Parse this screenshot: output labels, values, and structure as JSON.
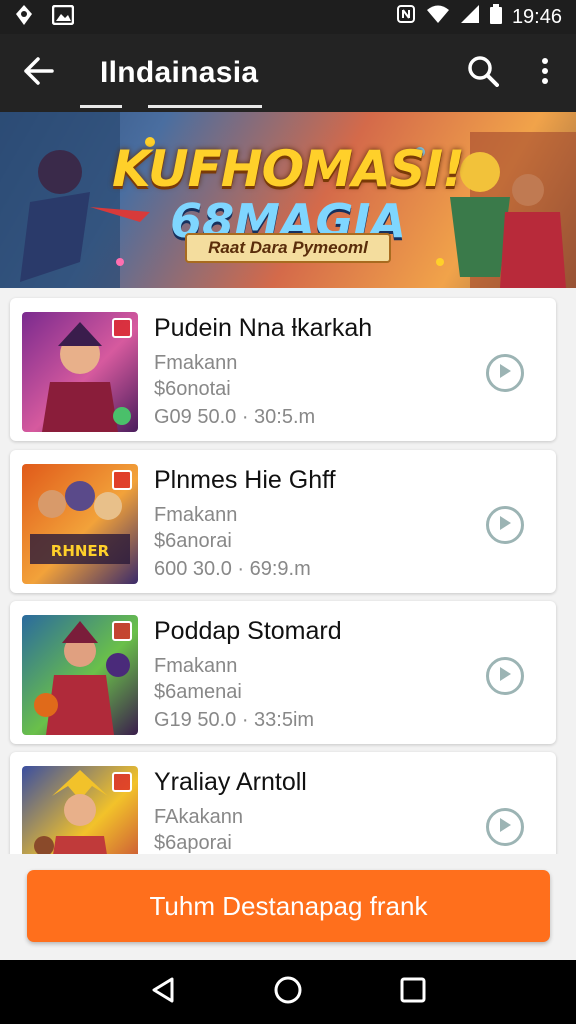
{
  "status_bar": {
    "time": "19:46",
    "icons": [
      "location-icon",
      "image-icon",
      "nfc-icon",
      "wifi-icon",
      "signal-icon",
      "battery-icon"
    ]
  },
  "app_bar": {
    "title": "Ilndainasia",
    "icons": [
      "back-arrow-icon",
      "search-icon",
      "more-vert-icon"
    ]
  },
  "banner": {
    "title_line1": "KUFHOMASI!",
    "title_line2": "68MAGIA",
    "ribbon": "Raat Dara Pymeoml"
  },
  "items": [
    {
      "title": "Pudein Nna ƚkarkah",
      "line1": "Fmakann",
      "line2": "$6onotai",
      "line3": "G09 50.0 · 30:5.m",
      "colors": [
        "#7a2a8e",
        "#d65a9e",
        "#4a1d5c"
      ]
    },
    {
      "title": "Plnmes Hie Ghff",
      "line1": "Fmakann",
      "line2": "$6anorai",
      "line3": "600 30.0 · 69:9.m",
      "colors": [
        "#e05a1a",
        "#f2a23a",
        "#3a2a6a"
      ]
    },
    {
      "title": "Poddap Stomard",
      "line1": "Fmakann",
      "line2": "$6amenai",
      "line3": "G19 50.0 · 33:5im",
      "colors": [
        "#2a6a9e",
        "#6ac04a",
        "#3a1d4c"
      ]
    },
    {
      "title": "Yraliay Arntoll",
      "line1": "FAkakann",
      "line2": "$6aporai",
      "line3": "",
      "colors": [
        "#3a4ea0",
        "#f2c22a",
        "#c03a3a"
      ]
    }
  ],
  "cta": {
    "label": "Tuhm Destanapag frank"
  },
  "nav": {
    "icons": [
      "back-triangle-icon",
      "home-circle-icon",
      "recents-square-icon"
    ]
  },
  "colors": {
    "accent": "#ff6f1c",
    "app_bar": "#232323",
    "status_bar": "#1e1e1e"
  }
}
